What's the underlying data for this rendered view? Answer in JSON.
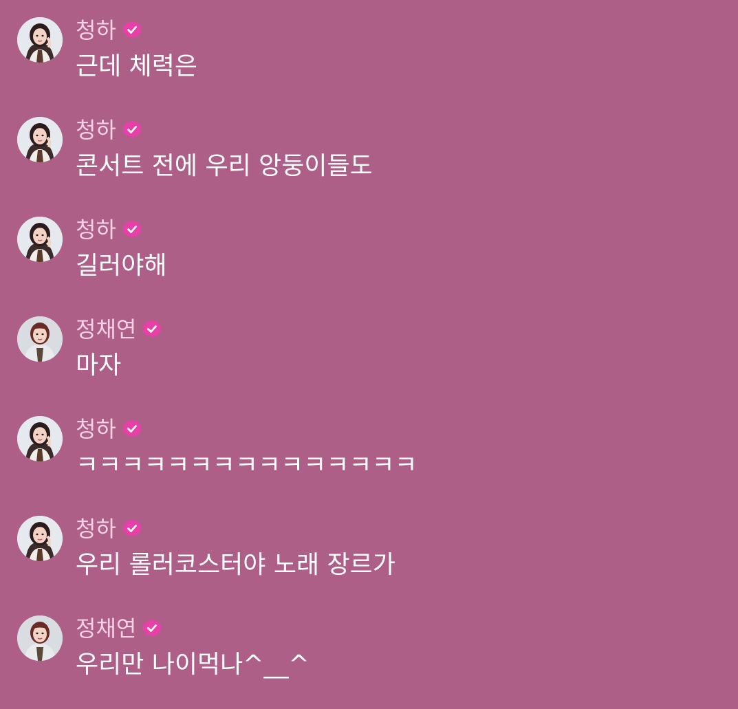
{
  "colors": {
    "background": "#ad5f88",
    "name_text": "#f6d2e4",
    "message_text": "#ffffff",
    "verified_badge": "#e83fa8"
  },
  "messages": [
    {
      "name": "청하",
      "text": "근데 체력은",
      "avatar_icon": "avatar-chungha-icon",
      "badge_icon": "verified-badge-icon"
    },
    {
      "name": "청하",
      "text": "콘서트 전에 우리 앙둥이들도",
      "avatar_icon": "avatar-chungha-icon",
      "badge_icon": "verified-badge-icon"
    },
    {
      "name": "청하",
      "text": "길러야해",
      "avatar_icon": "avatar-chungha-icon",
      "badge_icon": "verified-badge-icon"
    },
    {
      "name": "정채연",
      "text": "마자",
      "avatar_icon": "avatar-jungchaeyeon-icon",
      "badge_icon": "verified-badge-icon"
    },
    {
      "name": "청하",
      "text": "ㅋㅋㅋㅋㅋㅋㅋㅋㅋㅋㅋㅋㅋㅋㅋ",
      "avatar_icon": "avatar-chungha-icon",
      "badge_icon": "verified-badge-icon"
    },
    {
      "name": "청하",
      "text": "우리 롤러코스터야 노래 장르가",
      "avatar_icon": "avatar-chungha-icon",
      "badge_icon": "verified-badge-icon"
    },
    {
      "name": "정채연",
      "text": "우리만 나이먹나^__^",
      "avatar_icon": "avatar-jungchaeyeon-icon",
      "badge_icon": "verified-badge-icon"
    }
  ]
}
